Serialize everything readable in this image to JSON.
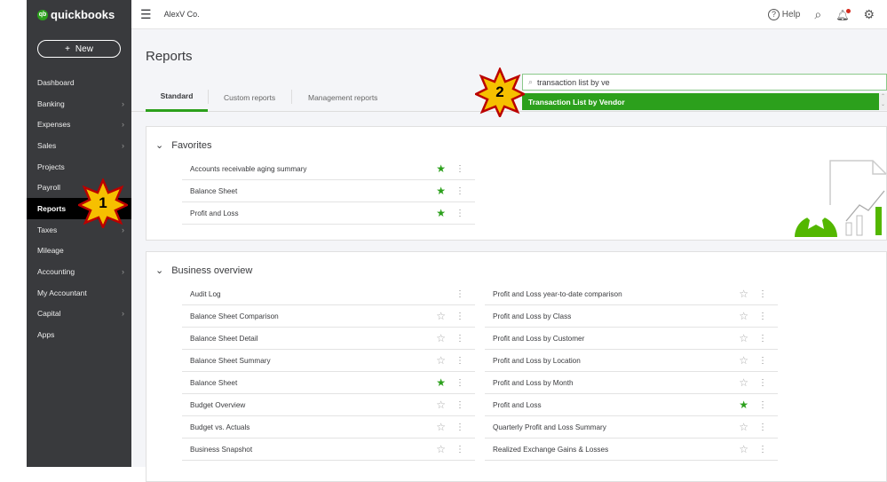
{
  "sidebar": {
    "logo": "quickbooks",
    "logo_small": "intuit",
    "new_label": "New",
    "items": [
      {
        "label": "Dashboard",
        "chev": false
      },
      {
        "label": "Banking",
        "chev": true
      },
      {
        "label": "Expenses",
        "chev": true
      },
      {
        "label": "Sales",
        "chev": true
      },
      {
        "label": "Projects",
        "chev": false
      },
      {
        "label": "Payroll",
        "chev": false
      },
      {
        "label": "Reports",
        "chev": false,
        "active": true
      },
      {
        "label": "Taxes",
        "chev": true
      },
      {
        "label": "Mileage",
        "chev": false
      },
      {
        "label": "Accounting",
        "chev": true
      },
      {
        "label": "My Accountant",
        "chev": false
      },
      {
        "label": "Capital",
        "chev": true
      },
      {
        "label": "Apps",
        "chev": false
      }
    ]
  },
  "topbar": {
    "company": "AlexV Co.",
    "help": "Help"
  },
  "page": {
    "title": "Reports",
    "tabs": [
      "Standard",
      "Custom reports",
      "Management reports"
    ]
  },
  "search": {
    "value": "transaction list by ve",
    "suggestion": "Transaction List by Vendor"
  },
  "annotations": {
    "step1": "1",
    "step2": "2"
  },
  "favorites": {
    "title": "Favorites",
    "items": [
      {
        "label": "Accounts receivable aging summary",
        "fav": true
      },
      {
        "label": "Balance Sheet",
        "fav": true
      },
      {
        "label": "Profit and Loss",
        "fav": true
      }
    ]
  },
  "business": {
    "title": "Business overview",
    "left": [
      {
        "label": "Audit Log",
        "fav": null
      },
      {
        "label": "Balance Sheet Comparison",
        "fav": false
      },
      {
        "label": "Balance Sheet Detail",
        "fav": false
      },
      {
        "label": "Balance Sheet Summary",
        "fav": false
      },
      {
        "label": "Balance Sheet",
        "fav": true
      },
      {
        "label": "Budget Overview",
        "fav": false
      },
      {
        "label": "Budget vs. Actuals",
        "fav": false
      },
      {
        "label": "Business Snapshot",
        "fav": false
      }
    ],
    "right": [
      {
        "label": "Profit and Loss year-to-date comparison",
        "fav": false
      },
      {
        "label": "Profit and Loss by Class",
        "fav": false
      },
      {
        "label": "Profit and Loss by Customer",
        "fav": false
      },
      {
        "label": "Profit and Loss by Location",
        "fav": false
      },
      {
        "label": "Profit and Loss by Month",
        "fav": false
      },
      {
        "label": "Profit and Loss",
        "fav": true
      },
      {
        "label": "Quarterly Profit and Loss Summary",
        "fav": false
      },
      {
        "label": "Realized Exchange Gains & Losses",
        "fav": false
      }
    ]
  },
  "colors": {
    "accent": "#2ca01c",
    "sidebar": "#393a3d"
  }
}
